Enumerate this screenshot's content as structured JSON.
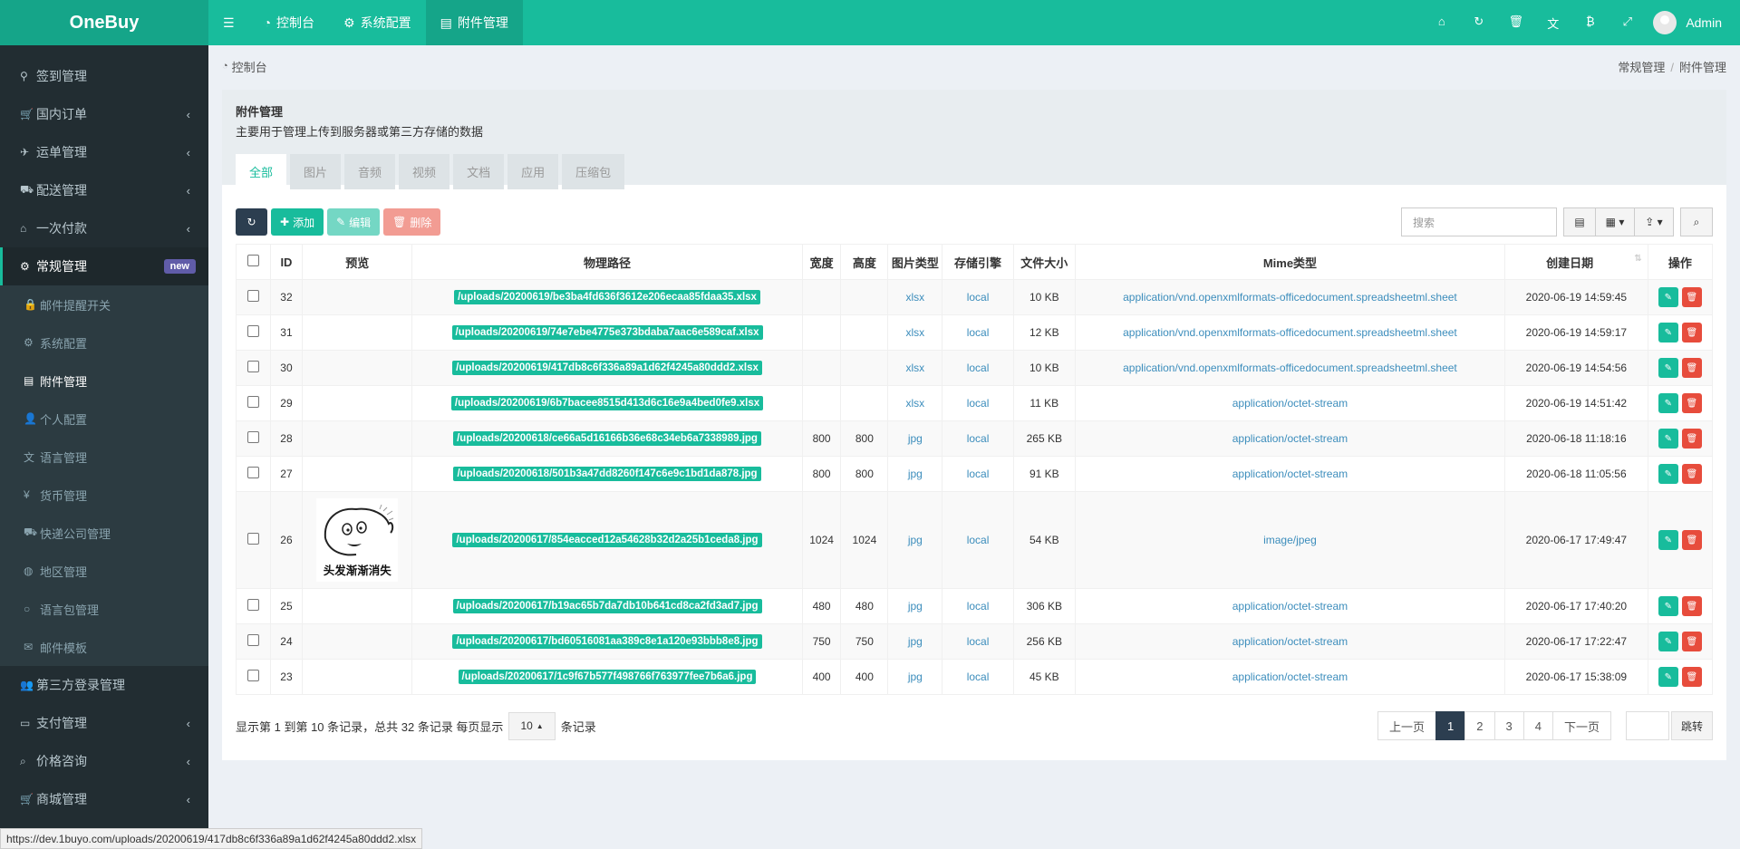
{
  "app": {
    "logo": "OneBuy",
    "admin": "Admin"
  },
  "topnav": [
    {
      "icon": "menu-icon",
      "glyph": "☰",
      "label": ""
    },
    {
      "icon": "dashboard-icon",
      "glyph": "◔",
      "label": "控制台"
    },
    {
      "icon": "cog-icon",
      "glyph": "⚙",
      "label": "系统配置"
    },
    {
      "icon": "file-image-icon",
      "glyph": "▤",
      "label": "附件管理"
    }
  ],
  "topright": [
    {
      "icon": "home-icon",
      "glyph": "⌂"
    },
    {
      "icon": "refresh-icon",
      "glyph": "↻"
    },
    {
      "icon": "trash-icon",
      "glyph": "🗑"
    },
    {
      "icon": "language-icon",
      "glyph": "文"
    },
    {
      "icon": "bitcoin-icon",
      "glyph": "₿"
    },
    {
      "icon": "fullscreen-icon",
      "glyph": "⤢"
    }
  ],
  "sidebar": {
    "items": [
      {
        "icon": "map-marker-icon",
        "glyph": "⚲",
        "label": "签到管理",
        "chev": false
      },
      {
        "icon": "cart-icon",
        "glyph": "🛒",
        "label": "国内订单",
        "chev": true
      },
      {
        "icon": "plane-icon",
        "glyph": "✈",
        "label": "运单管理",
        "chev": true
      },
      {
        "icon": "delivery-icon",
        "glyph": "⛟",
        "label": "配送管理",
        "chev": true
      },
      {
        "icon": "bank-icon",
        "glyph": "⌂",
        "label": "一次付款",
        "chev": true
      }
    ],
    "open": {
      "icon": "cogs-icon",
      "glyph": "⚙",
      "label": "常规管理",
      "badge": "new"
    },
    "sub": [
      {
        "icon": "lock-icon",
        "glyph": "🔒",
        "label": "邮件提醒开关"
      },
      {
        "icon": "cog-icon",
        "glyph": "⚙",
        "label": "系统配置"
      },
      {
        "icon": "file-image-icon",
        "glyph": "▤",
        "label": "附件管理",
        "active": true
      },
      {
        "icon": "user-icon",
        "glyph": "👤",
        "label": "个人配置"
      },
      {
        "icon": "language-icon",
        "glyph": "文",
        "label": "语言管理"
      },
      {
        "icon": "yen-icon",
        "glyph": "¥",
        "label": "货币管理"
      },
      {
        "icon": "truck-icon",
        "glyph": "⛟",
        "label": "快递公司管理"
      },
      {
        "icon": "globe-icon",
        "glyph": "◍",
        "label": "地区管理"
      },
      {
        "icon": "circle-icon",
        "glyph": "○",
        "label": "语言包管理"
      },
      {
        "icon": "envelope-icon",
        "glyph": "✉",
        "label": "邮件模板"
      }
    ],
    "after": [
      {
        "icon": "users-icon",
        "glyph": "👥",
        "label": "第三方登录管理",
        "chev": false
      },
      {
        "icon": "credit-card-icon",
        "glyph": "▭",
        "label": "支付管理",
        "chev": true
      },
      {
        "icon": "search-icon",
        "glyph": "⌕",
        "label": "价格咨询",
        "chev": true
      },
      {
        "icon": "cart-icon",
        "glyph": "🛒",
        "label": "商城管理",
        "chev": true
      }
    ]
  },
  "breadcrumb": {
    "left": "控制台",
    "right1": "常规管理",
    "sep": "/",
    "right2": "附件管理"
  },
  "panel": {
    "title": "附件管理",
    "subtitle": "主要用于管理上传到服务器或第三方存储的数据",
    "tabs": [
      "全部",
      "图片",
      "音频",
      "视频",
      "文档",
      "应用",
      "压缩包"
    ]
  },
  "toolbar": {
    "add": "添加",
    "edit": "编辑",
    "delete": "删除",
    "search_placeholder": "搜索"
  },
  "table": {
    "headers": [
      "ID",
      "预览",
      "物理路径",
      "宽度",
      "高度",
      "图片类型",
      "存储引擎",
      "文件大小",
      "Mime类型",
      "创建日期",
      "操作"
    ],
    "rows": [
      {
        "id": "32",
        "path": "/uploads/20200619/be3ba4fd636f3612e206ecaa85fdaa35.xlsx",
        "w": "",
        "h": "",
        "type": "xlsx",
        "engine": "local",
        "size": "10 KB",
        "mime": "application/vnd.openxmlformats-officedocument.spreadsheetml.sheet",
        "date": "2020-06-19 14:59:45"
      },
      {
        "id": "31",
        "path": "/uploads/20200619/74e7ebe4775e373bdaba7aac6e589caf.xlsx",
        "w": "",
        "h": "",
        "type": "xlsx",
        "engine": "local",
        "size": "12 KB",
        "mime": "application/vnd.openxmlformats-officedocument.spreadsheetml.sheet",
        "date": "2020-06-19 14:59:17"
      },
      {
        "id": "30",
        "path": "/uploads/20200619/417db8c6f336a89a1d62f4245a80ddd2.xlsx",
        "w": "",
        "h": "",
        "type": "xlsx",
        "engine": "local",
        "size": "10 KB",
        "mime": "application/vnd.openxmlformats-officedocument.spreadsheetml.sheet",
        "date": "2020-06-19 14:54:56"
      },
      {
        "id": "29",
        "path": "/uploads/20200619/6b7bacee8515d413d6c16e9a4bed0fe9.xlsx",
        "w": "",
        "h": "",
        "type": "xlsx",
        "engine": "local",
        "size": "11 KB",
        "mime": "application/octet-stream",
        "date": "2020-06-19 14:51:42"
      },
      {
        "id": "28",
        "path": "/uploads/20200618/ce66a5d16166b36e68c34eb6a7338989.jpg",
        "w": "800",
        "h": "800",
        "type": "jpg",
        "engine": "local",
        "size": "265 KB",
        "mime": "application/octet-stream",
        "date": "2020-06-18 11:18:16"
      },
      {
        "id": "27",
        "path": "/uploads/20200618/501b3a47dd8260f147c6e9c1bd1da878.jpg",
        "w": "800",
        "h": "800",
        "type": "jpg",
        "engine": "local",
        "size": "91 KB",
        "mime": "application/octet-stream",
        "date": "2020-06-18 11:05:56"
      },
      {
        "id": "26",
        "path": "/uploads/20200617/854eacced12a54628b32d2a25b1ceda8.jpg",
        "w": "1024",
        "h": "1024",
        "type": "jpg",
        "engine": "local",
        "size": "54 KB",
        "mime": "image/jpeg",
        "date": "2020-06-17 17:49:47",
        "preview_caption": "头发渐渐消失"
      },
      {
        "id": "25",
        "path": "/uploads/20200617/b19ac65b7da7db10b641cd8ca2fd3ad7.jpg",
        "w": "480",
        "h": "480",
        "type": "jpg",
        "engine": "local",
        "size": "306 KB",
        "mime": "application/octet-stream",
        "date": "2020-06-17 17:40:20"
      },
      {
        "id": "24",
        "path": "/uploads/20200617/bd60516081aa389c8e1a120e93bbb8e8.jpg",
        "w": "750",
        "h": "750",
        "type": "jpg",
        "engine": "local",
        "size": "256 KB",
        "mime": "application/octet-stream",
        "date": "2020-06-17 17:22:47"
      },
      {
        "id": "23",
        "path": "/uploads/20200617/1c9f67b577f498766f763977fee7b6a6.jpg",
        "w": "400",
        "h": "400",
        "type": "jpg",
        "engine": "local",
        "size": "45 KB",
        "mime": "application/octet-stream",
        "date": "2020-06-17 15:38:09"
      }
    ]
  },
  "footer": {
    "summary": "显示第 1 到第 10 条记录，总共 32 条记录 每页显示",
    "pagesize": "10",
    "records": "条记录",
    "prev": "上一页",
    "pages": [
      "1",
      "2",
      "3",
      "4"
    ],
    "next": "下一页",
    "jump": "跳转"
  },
  "statusbar": "https://dev.1buyo.com/uploads/20200619/417db8c6f336a89a1d62f4245a80ddd2.xlsx",
  "colors": {
    "primary": "#18bc9c",
    "sidebar": "#222d32",
    "danger": "#e74c3c",
    "dark": "#2c3e50",
    "link": "#3c8dbc"
  }
}
